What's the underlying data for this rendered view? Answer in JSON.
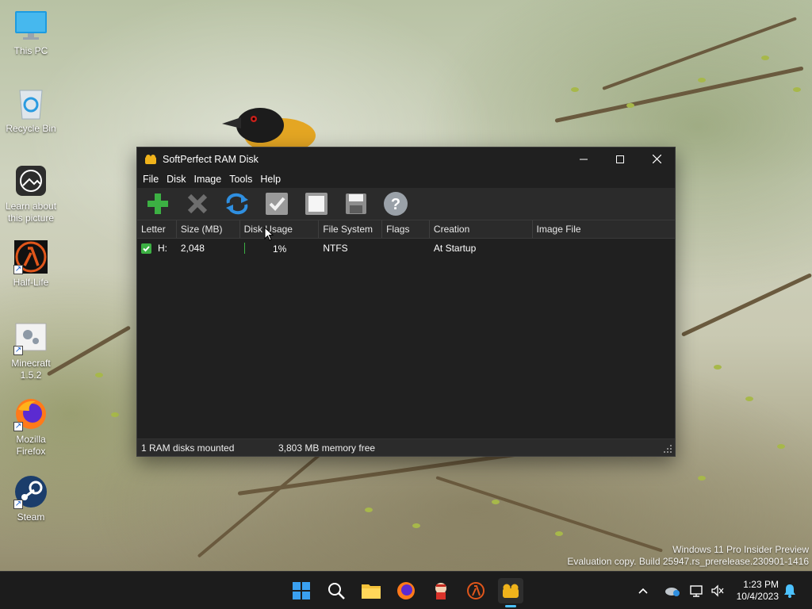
{
  "desktop": {
    "icons": [
      {
        "label": "This PC",
        "icon": "monitor-icon"
      },
      {
        "label": "Recycle Bin",
        "icon": "recycle-bin-icon"
      },
      {
        "label": "Learn about this picture",
        "icon": "camera-icon"
      },
      {
        "label": "Half-Life",
        "icon": "lambda-icon"
      },
      {
        "label": "Minecraft 1.5.2",
        "icon": "settings-file-icon"
      },
      {
        "label": "Mozilla Firefox",
        "icon": "firefox-icon"
      },
      {
        "label": "Steam",
        "icon": "steam-icon"
      }
    ]
  },
  "window": {
    "title": "SoftPerfect RAM Disk",
    "menu": [
      "File",
      "Disk",
      "Image",
      "Tools",
      "Help"
    ],
    "toolbar": [
      "add-disk",
      "remove-disk",
      "reload",
      "apply",
      "stop",
      "save-image",
      "help"
    ],
    "columns": [
      "Letter",
      "Size (MB)",
      "Disk Usage",
      "File System",
      "Flags",
      "Creation",
      "Image File"
    ],
    "rows": [
      {
        "letter": "H:",
        "size": "2,048",
        "usage": "1%",
        "usage_fraction": 0.01,
        "fs": "NTFS",
        "flags": "",
        "creation": "At Startup",
        "image": ""
      }
    ],
    "status": {
      "mounted": "1 RAM disks mounted",
      "memory": "3,803 MB memory free"
    }
  },
  "watermark": {
    "line1": "Windows 11 Pro Insider Preview",
    "line2": "Evaluation copy. Build 25947.rs_prerelease.230901-1416"
  },
  "taskbar": {
    "apps": [
      "start-icon",
      "search-icon",
      "file-explorer-icon",
      "firefox-icon",
      "game-icon",
      "half-life-icon",
      "ram-disk-icon"
    ],
    "time": "1:23 PM",
    "date": "10/4/2023"
  },
  "colors": {
    "window_bg": "#202020",
    "toolbar_bg": "#2b2b2b",
    "accent_green": "#3cb043",
    "accent_blue": "#2f8fe0"
  }
}
